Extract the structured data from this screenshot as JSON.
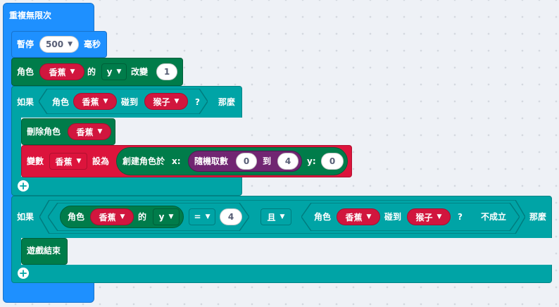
{
  "forever": {
    "label": "重複無限次"
  },
  "pause": {
    "label": "暫停",
    "value": "500",
    "unit": "毫秒"
  },
  "change": {
    "prefix": "角色",
    "sprite": "香蕉",
    "of": "的",
    "prop": "y",
    "verb": "改變",
    "value": "1"
  },
  "if1": {
    "if_label": "如果",
    "cond_prefix": "角色",
    "cond_sprite": "香蕉",
    "touch_label": "碰到",
    "target": "猴子",
    "question": "?",
    "then_label": "那麼"
  },
  "delete": {
    "label": "刪除角色",
    "sprite": "香蕉"
  },
  "setvar": {
    "prefix": "變數",
    "var": "香蕉",
    "set_label": "設為",
    "create_label": "創建角色於",
    "x_label": "x:",
    "random_label": "隨機取數",
    "rand_from": "0",
    "rand_to_label": "到",
    "rand_to": "4",
    "y_label": "y:",
    "y_value": "0"
  },
  "if2": {
    "if_label": "如果",
    "cond_prefix": "角色",
    "cond_sprite": "香蕉",
    "of": "的",
    "prop": "y",
    "op": "=",
    "value": "4",
    "and_label": "且",
    "not_prefix": "角色",
    "not_sprite": "香蕉",
    "touch_label": "碰到",
    "target": "猴子",
    "question": "?",
    "not_label": "不成立",
    "then_label": "那麼"
  },
  "gameover": {
    "label": "遊戲結束"
  },
  "colors": {
    "loops": "#1e90ff",
    "logic": "#00a4a6",
    "sprites": "#007c4a",
    "math": "#712672",
    "variables": "#dc143c"
  }
}
